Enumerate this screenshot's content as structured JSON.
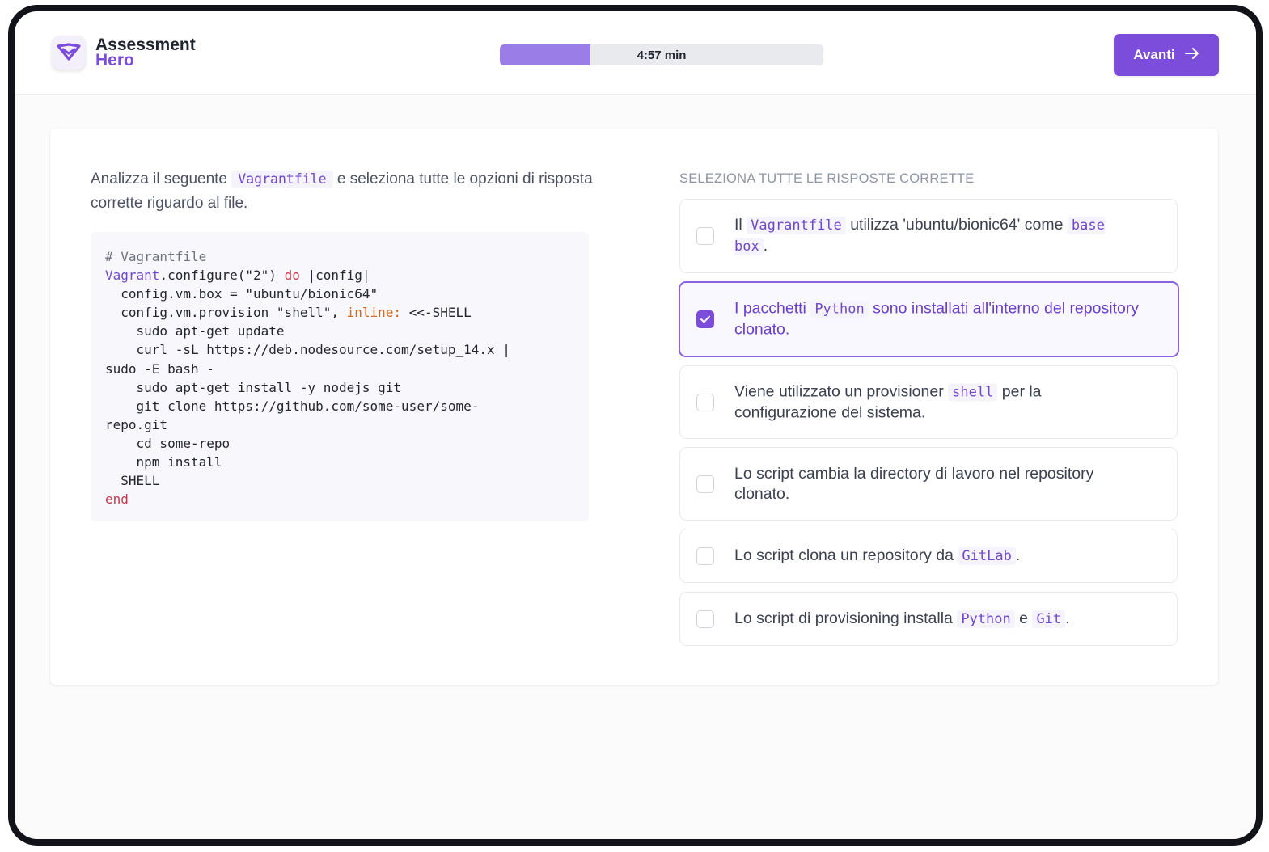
{
  "app": {
    "logo_line1": "Assessment",
    "logo_line2": "Hero",
    "logo_icon": "heart-shield-icon"
  },
  "timer": {
    "label": "4:57 min",
    "progress_fraction": 0.28
  },
  "header": {
    "next_label": "Avanti",
    "next_icon": "arrow-right-icon"
  },
  "question": {
    "text_before": "Analizza il seguente",
    "code": "Vagrantfile",
    "text_after": "e seleziona tutte le opzioni di risposta corrette riguardo al file."
  },
  "code_block": {
    "lines": [
      "# Vagrantfile",
      "Vagrant.configure(\"2\") do |config|",
      "  config.vm.box = \"ubuntu/bionic64\"",
      "  config.vm.provision \"shell\", inline: <<-SHELL",
      "    sudo apt-get update",
      "    curl -sL https://deb.nodesource.com/setup_14.x |",
      "sudo -E bash -",
      "    sudo apt-get install -y nodejs git",
      "    git clone https://github.com/some-user/some-",
      "repo.git",
      "    cd some-repo",
      "    npm install",
      "  SHELL",
      "end"
    ]
  },
  "answers": {
    "heading": "SELEZIONA TUTTE LE RISPOSTE CORRETTE",
    "options": [
      {
        "t1": "Il",
        "c1": "Vagrantfile",
        "t2": "utilizza 'ubuntu/bionic64' come",
        "c2": "base box",
        "t3": ".",
        "checked": false
      },
      {
        "t1": "I pacchetti",
        "c1": "Python",
        "t2": "sono installati all'interno del repository clonato.",
        "c2": "",
        "t3": "",
        "checked": true
      },
      {
        "t1": "Viene utilizzato un provisioner",
        "c1": "shell",
        "t2": "per la configurazione del sistema.",
        "c2": "",
        "t3": "",
        "checked": false
      },
      {
        "t1": "Lo script cambia la directory di lavoro nel repository clonato.",
        "c1": "",
        "t2": "",
        "c2": "",
        "t3": "",
        "checked": false
      },
      {
        "t1": "Lo script clona un repository da",
        "c1": "GitLab",
        "t2": ".",
        "c2": "",
        "t3": "",
        "checked": false
      },
      {
        "t1": "Lo script di provisioning installa",
        "c1": "Python",
        "t2": "e",
        "c2": "Git",
        "t3": ".",
        "checked": false
      }
    ]
  },
  "colors": {
    "accent": "#7c4ddb",
    "progress_fill": "#9a7de6",
    "selected_border": "#8a63de"
  }
}
